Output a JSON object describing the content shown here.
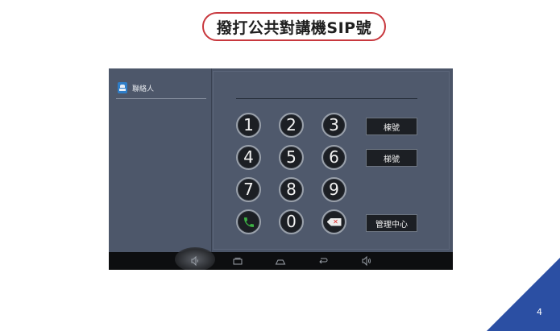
{
  "slide": {
    "title": "撥打公共對講機SIP號",
    "page_number": "4",
    "accent_color": "#c8383e",
    "corner_color": "#2b4fa3"
  },
  "contacts_panel": {
    "label": "聯絡人",
    "icon": "contacts-icon"
  },
  "keypad": {
    "keys": [
      {
        "label": "1",
        "name": "key-1"
      },
      {
        "label": "2",
        "name": "key-2"
      },
      {
        "label": "3",
        "name": "key-3"
      },
      {
        "label": "4",
        "name": "key-4"
      },
      {
        "label": "5",
        "name": "key-5"
      },
      {
        "label": "6",
        "name": "key-6"
      },
      {
        "label": "7",
        "name": "key-7"
      },
      {
        "label": "8",
        "name": "key-8"
      },
      {
        "label": "9",
        "name": "key-9"
      },
      {
        "label": "0",
        "name": "key-0"
      }
    ],
    "call_icon": "phone-icon",
    "delete_icon": "backspace-icon",
    "call_color": "#3cb043"
  },
  "side_buttons": {
    "building": "棟號",
    "elevator": "梯號",
    "management": "管理中心"
  },
  "nav_bar": {
    "icons": [
      "volume-down-icon",
      "recent-apps-icon",
      "home-icon",
      "back-icon",
      "volume-up-icon"
    ]
  }
}
